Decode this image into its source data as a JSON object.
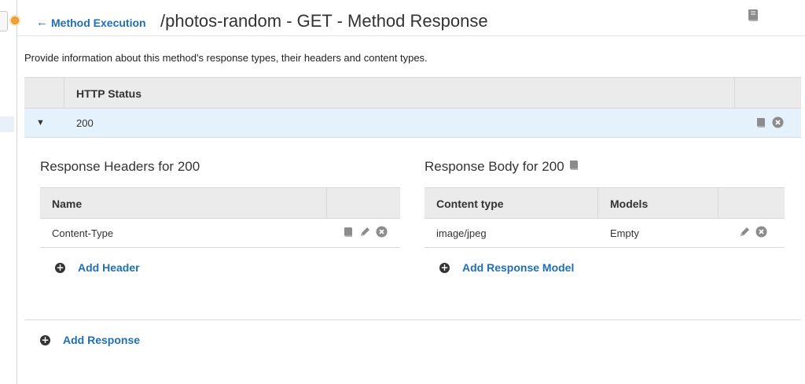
{
  "header": {
    "back_label": "Method Execution",
    "title": "/photos-random - GET - Method Response"
  },
  "description": "Provide information about this method's response types, their headers and content types.",
  "status_table": {
    "header": "HTTP Status",
    "rows": [
      {
        "code": "200"
      }
    ]
  },
  "headers_section": {
    "title": "Response Headers for 200",
    "columns": [
      "Name"
    ],
    "rows": [
      {
        "name": "Content-Type"
      }
    ],
    "add_label": "Add Header"
  },
  "body_section": {
    "title": "Response Body for 200",
    "columns": [
      "Content type",
      "Models"
    ],
    "rows": [
      {
        "content_type": "image/jpeg",
        "model": "Empty"
      }
    ],
    "add_label": "Add Response Model"
  },
  "add_response_label": "Add Response",
  "colors": {
    "link": "#1f6fb5",
    "row_selected": "#e6f2fb",
    "table_header": "#ebebeb",
    "accent_orange": "#f0a23a"
  },
  "icons": [
    "back-arrow-icon",
    "book-icon",
    "pencil-icon",
    "close-circle-icon",
    "caret-down-icon",
    "plus-circle-icon"
  ]
}
